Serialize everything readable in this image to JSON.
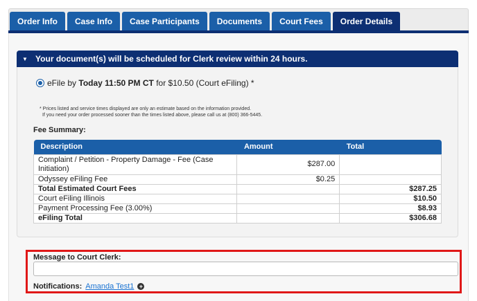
{
  "tabs": [
    {
      "label": "Order Info"
    },
    {
      "label": "Case Info"
    },
    {
      "label": "Case Participants"
    },
    {
      "label": "Documents"
    },
    {
      "label": "Court Fees"
    },
    {
      "label": "Order Details"
    }
  ],
  "active_tab": "Order Details",
  "panel": {
    "header": "Your document(s) will be scheduled for Clerk review within 24 hours.",
    "efile_prefix": "eFile by",
    "efile_time": "Today 11:50 PM CT",
    "efile_suffix": "for $10.50 (Court eFiling) *",
    "note_line1": "* Prices listed and service times displayed are only an estimate based on the information provided.",
    "note_line2": "If you need your order processed sooner than the times listed above, please call us at (800) 366-5445.",
    "fee_summary_title": "Fee Summary:"
  },
  "fee_table": {
    "headers": [
      "Description",
      "Amount",
      "Total"
    ],
    "rows": [
      [
        "Complaint / Petition - Property Damage - Fee (Case Initiation)",
        "$287.00",
        ""
      ],
      [
        "Odyssey eFiling Fee",
        "$0.25",
        ""
      ],
      [
        "Total Estimated Court Fees",
        "",
        "$287.25"
      ],
      [
        "Court eFiling Illinois",
        "",
        "$10.50"
      ],
      [
        "Payment Processing Fee (3.00%)",
        "",
        "$8.93"
      ],
      [
        "eFiling Total",
        "",
        "$306.68"
      ]
    ]
  },
  "message": {
    "label": "Message to Court Clerk:",
    "value": "",
    "placeholder": ""
  },
  "notifications": {
    "label": "Notifications:",
    "recipient": "Amanda Test1"
  },
  "colors": {
    "tab_blue": "#1b5fa8",
    "tab_active": "#0d2f73",
    "highlight_red": "#e01818",
    "link_blue": "#1b73d2"
  }
}
